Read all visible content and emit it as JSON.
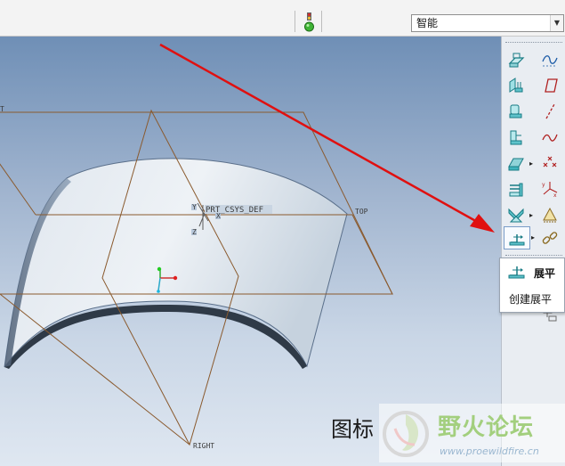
{
  "top_toolbar": {
    "selection_filter": {
      "value": "智能"
    }
  },
  "model": {
    "csys_label": "PRT_CSYS_DEF",
    "datum_planes": {
      "top": "TOP",
      "right": "RIGHT",
      "front_partial": "T"
    },
    "tags": {
      "tag_top": "Y",
      "tag_bottom": "Z",
      "tag_small": "X"
    }
  },
  "tooltip": {
    "title": "展平",
    "description": "创建展平"
  },
  "watermark": {
    "label": "图标",
    "title": "野火论坛",
    "url": "www.proewildfire.cn"
  },
  "colors": {
    "datum": "#8a5a2e",
    "arrow": "#e01010",
    "surface": "#c7d3df",
    "edge": "#5a6f8a",
    "accent": "#7a9cc8",
    "toolbar_bg": "#e9edf2"
  },
  "icons": {
    "traffic_light": "traffic-light-icon",
    "unbend_tool": "unbend-icon"
  }
}
